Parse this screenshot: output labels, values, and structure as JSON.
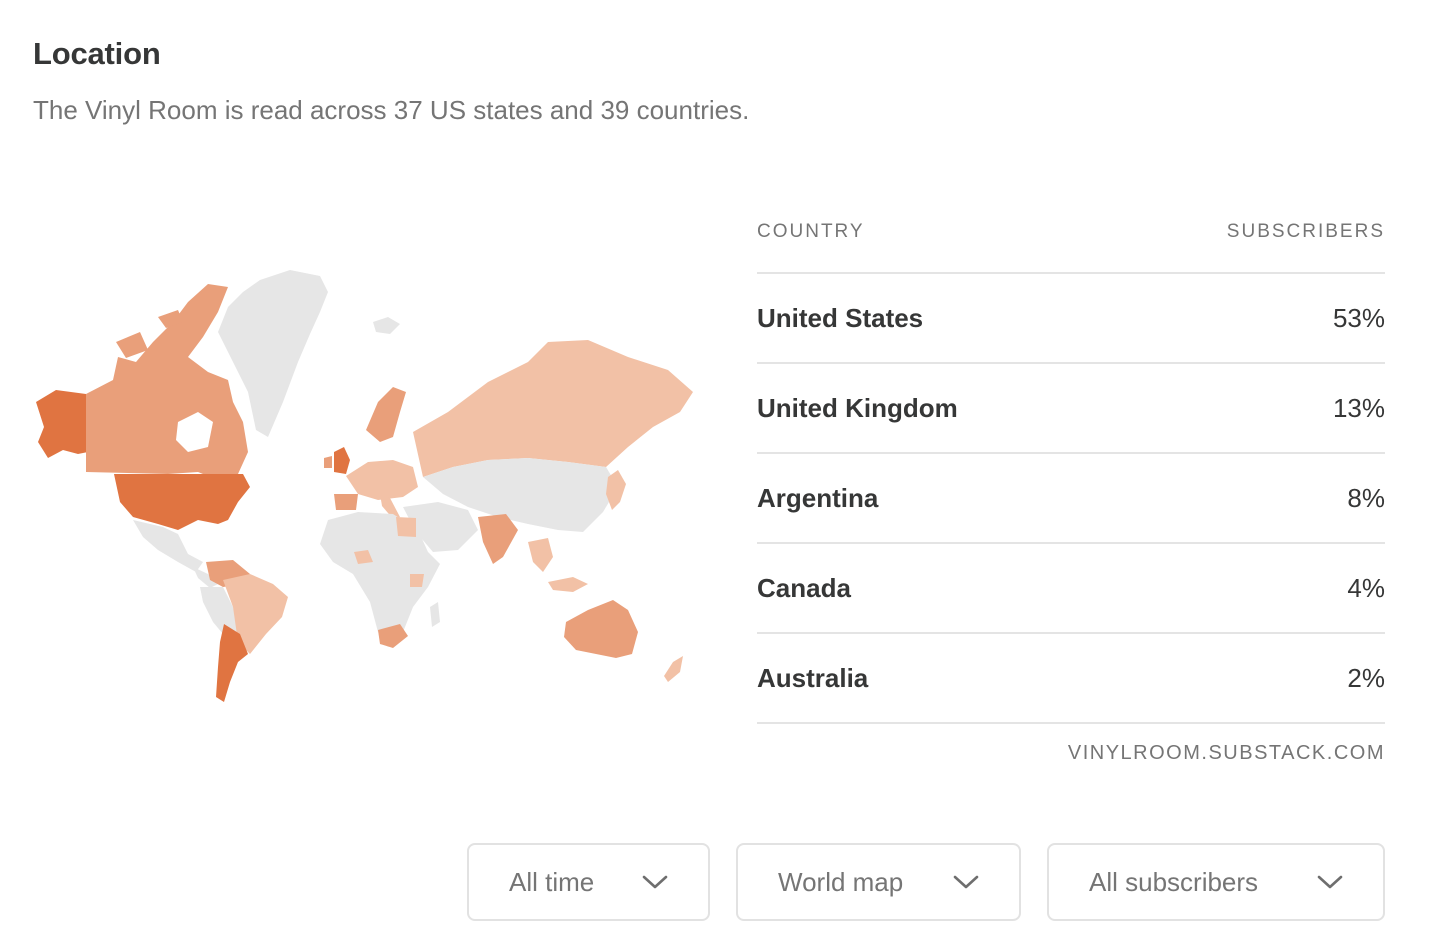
{
  "header": {
    "title": "Location",
    "subtitle": "The Vinyl Room is read across 37 US states and 39 countries."
  },
  "table": {
    "col_country": "COUNTRY",
    "col_subscribers": "SUBSCRIBERS",
    "rows": [
      {
        "country": "United States",
        "share": "53%"
      },
      {
        "country": "United Kingdom",
        "share": "13%"
      },
      {
        "country": "Argentina",
        "share": "8%"
      },
      {
        "country": "Canada",
        "share": "4%"
      },
      {
        "country": "Australia",
        "share": "2%"
      }
    ]
  },
  "source": "VINYLROOM.SUBSTACK.COM",
  "filters": {
    "time": "All time",
    "view": "World map",
    "audience": "All subscribers"
  },
  "colors": {
    "high": "#e07441",
    "mid": "#e99f7a",
    "low": "#f2c1a6",
    "none": "#e6e6e6",
    "text": "#363737",
    "muted": "#757575"
  }
}
